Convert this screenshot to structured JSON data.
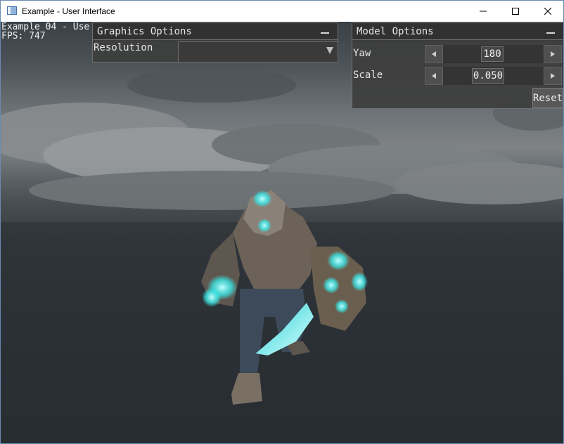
{
  "window": {
    "title": "Example - User Interface",
    "icon": "app-window-icon",
    "controls": {
      "minimize_icon": "minimize-icon",
      "maximize_icon": "maximize-icon",
      "close_icon": "close-icon"
    }
  },
  "hud": {
    "line1": "Example 04 - Use",
    "line2": "FPS: 747"
  },
  "graphics_panel": {
    "title": "Graphics Options",
    "resolution_label": "Resolution",
    "resolution_value": ""
  },
  "model_panel": {
    "title": "Model Options",
    "yaw_label": "Yaw",
    "yaw_value": "180",
    "scale_label": "Scale",
    "scale_value": "0.050",
    "reset_label": "Reset"
  },
  "colors": {
    "panel_bg": "#3e3e3e",
    "glow_accent": "#39e6e6"
  }
}
